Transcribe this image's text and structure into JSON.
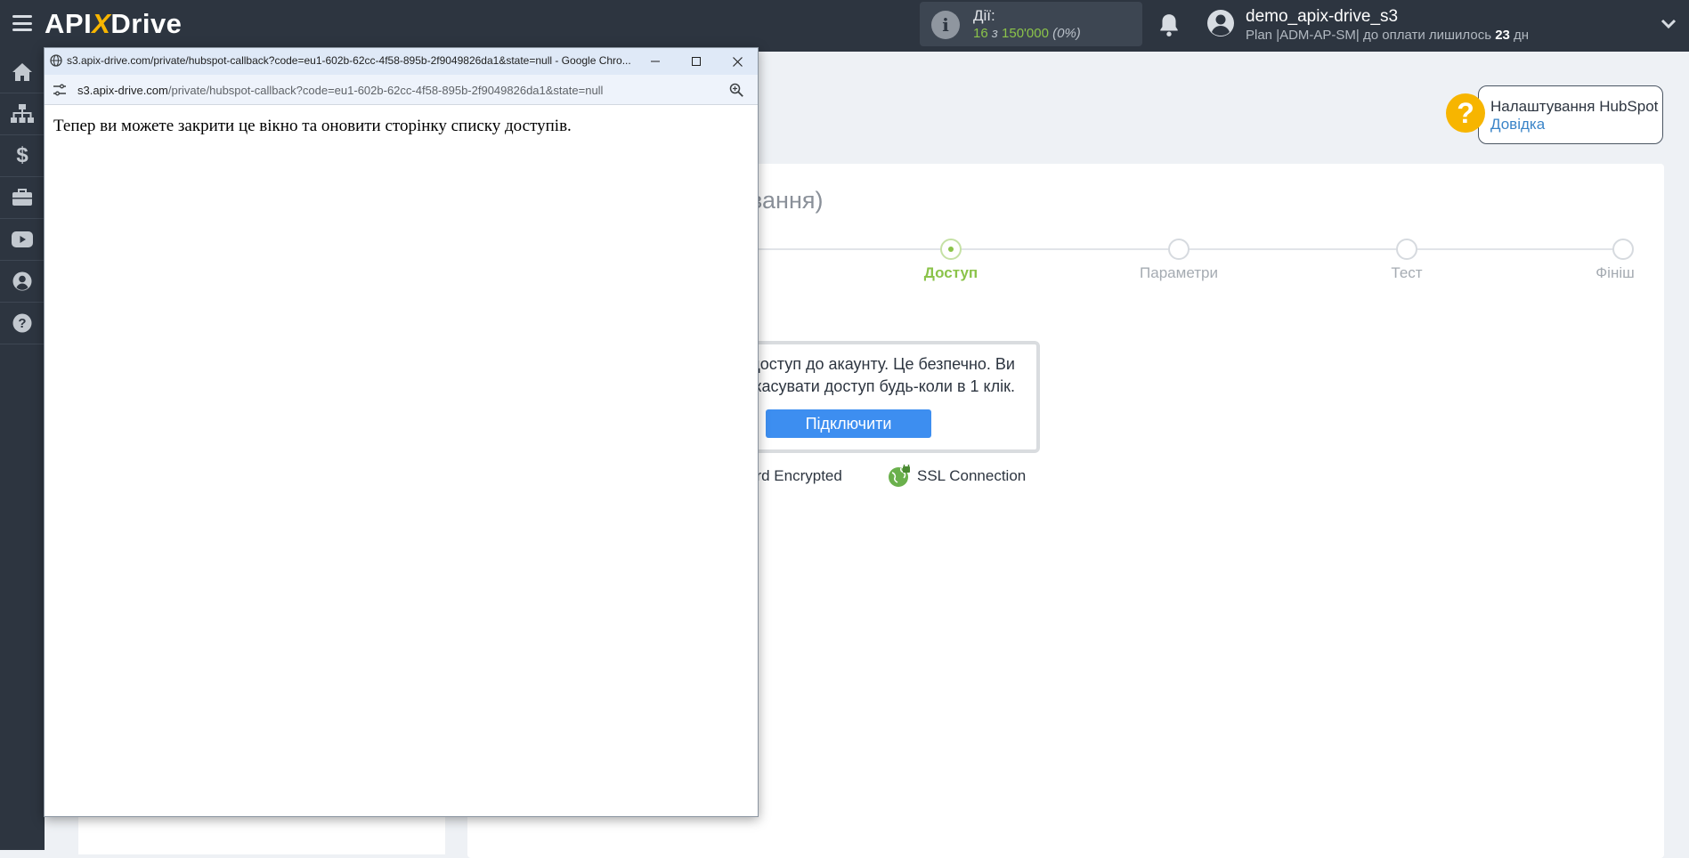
{
  "topbar": {
    "logo_api": "API",
    "logo_x": "X",
    "logo_drive": "Drive",
    "actions_label": "Дії:",
    "actions_used": "16",
    "actions_of": "з",
    "actions_total": "150'000",
    "actions_percent": "(0%)",
    "username": "demo_apix-drive_s3",
    "plan_text": "Plan |ADM-AP-SM| до оплати лишилось",
    "plan_days": "23",
    "plan_days_unit": "дн"
  },
  "sidebar": {
    "items": [
      "home-icon",
      "sitemap-icon",
      "dollar-icon",
      "briefcase-icon",
      "youtube-icon",
      "user-icon",
      "help-icon"
    ]
  },
  "help": {
    "title": "Налаштування HubSpot",
    "link": "Довідка"
  },
  "main": {
    "heading": "вання)",
    "steps": [
      {
        "label": "Доступ",
        "active": true
      },
      {
        "label": "Параметри",
        "active": false
      },
      {
        "label": "Тест",
        "active": false
      },
      {
        "label": "Фініш",
        "active": false
      }
    ],
    "connect_text_line1": "доступ до акаунту. Це безпечно. Ви",
    "connect_text_line2": "касувати доступ будь-коли в 1 клік.",
    "connect_button": "Підключити",
    "encrypted": "ord Encrypted",
    "ssl": "SSL Connection"
  },
  "popup": {
    "title": "s3.apix-drive.com/private/hubspot-callback?code=eu1-602b-62cc-4f58-895b-2f9049826da1&state=null - Google Chro...",
    "url_host": "s3.apix-drive.com",
    "url_rest": "/private/hubspot-callback?code=eu1-602b-62cc-4f58-895b-2f9049826da1&state=null",
    "message": "Тепер ви можете закрити це вікно та оновити сторінку списку доступів."
  },
  "colors": {
    "topbar": "#2d3540",
    "accent_green": "#8bc34a",
    "accent_yellow": "#f7b500",
    "button_blue": "#3d8ef0"
  }
}
